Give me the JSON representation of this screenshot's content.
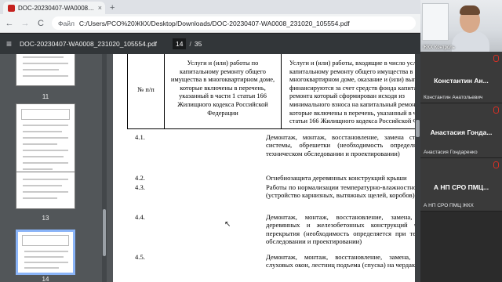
{
  "browser": {
    "tab_title": "DOC-20230407-WA0008_231020_",
    "tab_close": "×",
    "new_tab": "+",
    "back": "←",
    "forward": "→",
    "reload": "C",
    "url_scheme": "Файл",
    "url_path": "C:/Users/PCO%20ЖКХ/Desktop/Downloads/DOC-20230407-WA0008_231020_105554.pdf"
  },
  "pdf": {
    "menu_glyph": "≡",
    "filename": "DOC-20230407-WA0008_231020_105554.pdf",
    "current_page": "14",
    "page_sep": "/",
    "total_pages": "35"
  },
  "thumbnails": [
    {
      "label": "11"
    },
    {
      "label": "12"
    },
    {
      "label": "13"
    },
    {
      "label": "14",
      "selected": true
    }
  ],
  "table_header": {
    "col1": "№ п/п",
    "col2": "Услуги и (или) работы по капитальному ремонту общего имущества в многоквартирном доме, которые включены в перечень, указанный в части 1 статьи 166 Жилищного кодекса Российской Федерации",
    "col3": "Услуги и (или) работы, входящие в число услуг по капитальному ремонту общего имущества в многоквартирном доме, оказание и (или) выполнение финансируются за счет средств фонда капитального ремонта который сформирован исходя из минимального взноса на капитальный ремонт, и которые включены в перечень, указанный в части 1 статьи 166 Жилищного кодекса Российской Федерации"
  },
  "table_rows": [
    {
      "num": "4.1.",
      "text": "Демонтаж, монтаж, восстановление, замена стропильной системы, обрешетки (необходимость определяется при техническом обследовании и проектировании)"
    },
    {
      "num": "4.2.",
      "text": "Огнебиозащита деревянных конструкций крыши"
    },
    {
      "num": "4.3.",
      "text": "Работы по нормализации температурно-влажностного режима (устройство карнизных, вытяжных щелей, коробов)"
    },
    {
      "num": "4.4.",
      "text": "Демонтаж, монтаж, восстановление, замена, усиление деревянных и железобетонных конструкций чердачного перекрытия (необходимость определяется при техническом обследовании и проектировании)"
    },
    {
      "num": "4.5.",
      "text": "Демонтаж, монтаж, восстановление, замена, установка слуховых окон, лестниц подъема (спуска) на чердак и кровлю"
    }
  ],
  "call": {
    "self_label": "ЖКХ Контроль",
    "participants": [
      {
        "display": "Константин    Ан...",
        "name": "Константин   Анатольевич"
      },
      {
        "display": "Анастасия  Гонда...",
        "name": "Анастасия Гондаренко"
      },
      {
        "display": "А НП СРО ПМЦ...",
        "name": "А НП СРО ПМЦ ЖКХ"
      }
    ]
  },
  "colors": {
    "pdf_toolbar": "#323639",
    "viewer_bg": "#525659",
    "selected_thumb": "#8ab4f8",
    "call_bg": "#2b2b2b"
  }
}
